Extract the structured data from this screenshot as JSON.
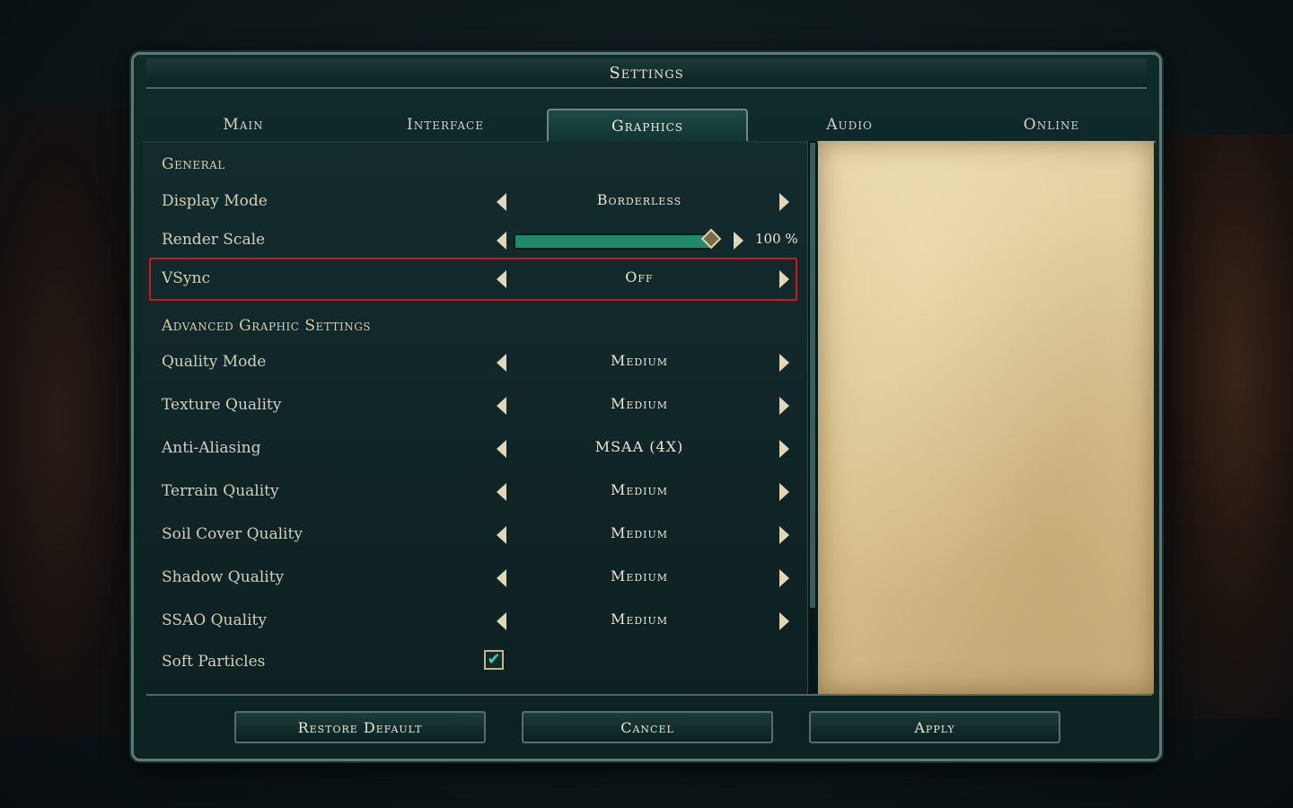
{
  "window": {
    "title": "Settings"
  },
  "tabs": [
    {
      "label": "Main"
    },
    {
      "label": "Interface"
    },
    {
      "label": "Graphics"
    },
    {
      "label": "Audio"
    },
    {
      "label": "Online"
    }
  ],
  "active_tab": "Graphics",
  "general": {
    "header": "General",
    "display_mode": {
      "label": "Display Mode",
      "value": "Borderless"
    },
    "render_scale": {
      "label": "Render Scale",
      "value": "100 %",
      "fill": 1.0
    },
    "vsync": {
      "label": "VSync",
      "value": "Off"
    }
  },
  "advanced": {
    "header": "Advanced Graphic Settings",
    "quality_mode": {
      "label": "Quality Mode",
      "value": "Medium"
    },
    "texture_quality": {
      "label": "Texture Quality",
      "value": "Medium"
    },
    "anti_aliasing": {
      "label": "Anti-Aliasing",
      "value": "MSAA (4X)"
    },
    "terrain_quality": {
      "label": "Terrain Quality",
      "value": "Medium"
    },
    "soil_cover_quality": {
      "label": "Soil Cover Quality",
      "value": "Medium"
    },
    "shadow_quality": {
      "label": "Shadow Quality",
      "value": "Medium"
    },
    "ssao_quality": {
      "label": "SSAO Quality",
      "value": "Medium"
    },
    "soft_particles": {
      "label": "Soft Particles",
      "checked": true,
      "check_glyph": "✔"
    }
  },
  "buttons": {
    "restore_default": "Restore Default",
    "cancel": "Cancel",
    "apply": "Apply"
  },
  "colors": {
    "highlight": "#d0161c",
    "slider_fill": "#1f8a6a",
    "checkbox_check": "#3ad2a6",
    "parchment": "#dcc796"
  }
}
